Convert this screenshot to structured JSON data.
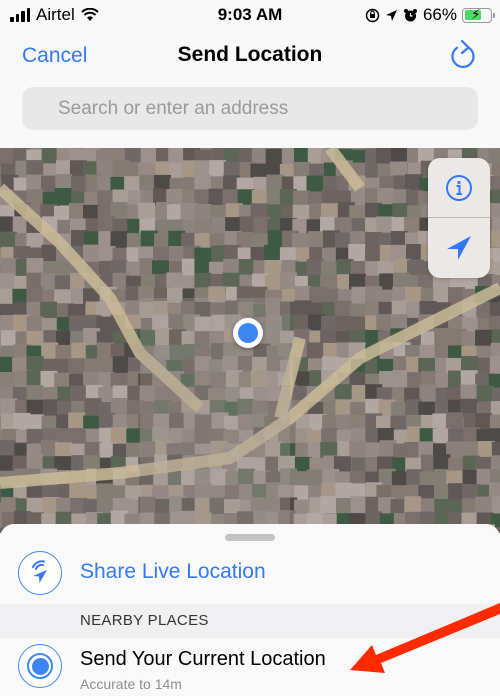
{
  "status_bar": {
    "carrier": "Airtel",
    "time": "9:03 AM",
    "battery_percent": "66%",
    "battery_level": 0.66,
    "icons": [
      "signal-icon",
      "wifi-icon",
      "orientation-lock-icon",
      "location-arrow-icon",
      "alarm-icon",
      "battery-charging-icon"
    ]
  },
  "navbar": {
    "cancel_label": "Cancel",
    "title": "Send Location",
    "refresh_icon": "refresh-icon"
  },
  "search": {
    "placeholder": "Search or enter an address",
    "value": ""
  },
  "map": {
    "controls": [
      {
        "icon": "info-icon",
        "label": "Map info"
      },
      {
        "icon": "location-arrow-icon",
        "label": "Current location"
      }
    ],
    "user_location_icon": "user-location-dot"
  },
  "sheet": {
    "share_live_label": "Share Live Location",
    "section_header": "NEARBY PLACES",
    "current_location": {
      "title": "Send Your Current Location",
      "subtitle": "Accurate to 14m"
    }
  },
  "colors": {
    "accent": "#3478f6",
    "annotation_arrow": "#ff2a00"
  }
}
